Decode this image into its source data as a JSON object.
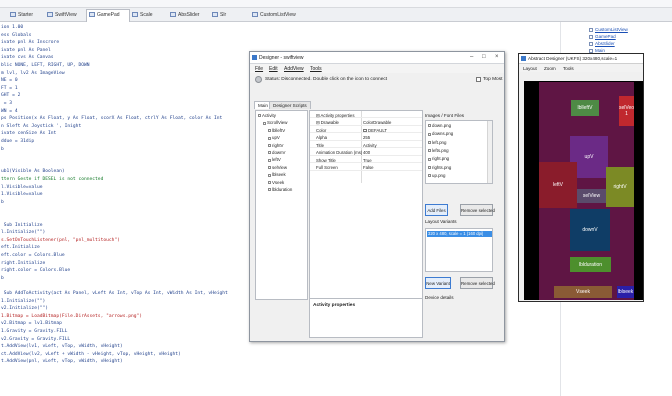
{
  "ide_tabs": [
    {
      "label": "Starter"
    },
    {
      "label": "SwiftView"
    },
    {
      "label": "GamePad",
      "active": true
    },
    {
      "label": "Scale"
    },
    {
      "label": "AbsSlider"
    },
    {
      "label": "Slr"
    },
    {
      "label": "CustomListView"
    }
  ],
  "code_lines": [
    {
      "text": "ion 1.00",
      "style": "blue"
    },
    {
      "text": "ess Globals",
      "style": "blue"
    },
    {
      "text": "ivate pnl As Inscrore",
      "style": "blue"
    },
    {
      "text": "ivate pnl As Panel",
      "style": "blue"
    },
    {
      "text": "ivate cvs As Canvas",
      "style": "blue"
    },
    {
      "text": "blic NONE, LEFT, RIGHT, UP, DOWN",
      "style": "blue"
    },
    {
      "text": "m lvl, lv2 As ImageView",
      "style": "blue"
    },
    {
      "text": "NE = 0",
      "style": "blue"
    },
    {
      "text": "FT = 1",
      "style": "blue"
    },
    {
      "text": "GHT = 2",
      "style": "blue"
    },
    {
      "text": " = 3",
      "style": "blue"
    },
    {
      "text": "WN = 4",
      "style": "blue"
    },
    {
      "text": "ps Position(x As Float, y As Float, scorX As Float, ctrlY As Float, color As Int",
      "style": "blue"
    },
    {
      "text": "n Sleft As Joystick ', Inight",
      "style": "blue"
    },
    {
      "text": "ivate cenSize As Int",
      "style": "blue"
    },
    {
      "text": "ddue = 31dip",
      "style": "blue"
    },
    {
      "text": "b",
      "style": "blue"
    },
    {
      "text": "",
      "style": "blue"
    },
    {
      "text": "",
      "style": "blue"
    },
    {
      "text": "ub1(Visible As Boolean)",
      "style": "blue"
    },
    {
      "text": "ttern Geste if DESEL is not connected",
      "style": "green"
    },
    {
      "text": "l.Visible=value",
      "style": "blue"
    },
    {
      "text": "1.Visible=value",
      "style": "blue"
    },
    {
      "text": "b",
      "style": "blue"
    },
    {
      "text": "",
      "style": "blue"
    },
    {
      "text": "",
      "style": "blue"
    },
    {
      "text": " Sub Initialize",
      "style": "blue"
    },
    {
      "text": "l.Initialize(\"\")",
      "style": "blue"
    },
    {
      "text": "s.SetOnTouchListener(pnl, \"pnl_multitouch\")",
      "style": "red"
    },
    {
      "text": "eft.Initialize",
      "style": "blue"
    },
    {
      "text": "eft.color = Colors.Blue",
      "style": "blue"
    },
    {
      "text": "right.Initialize",
      "style": "blue"
    },
    {
      "text": "right.color = Colors.Blue",
      "style": "blue"
    },
    {
      "text": "b",
      "style": "blue"
    },
    {
      "text": "",
      "style": "blue"
    },
    {
      "text": " Sub AddToActivity(act As Panel, vLeft As Int, vTop As Int, vWidth As Int, vHeight",
      "style": "blue"
    },
    {
      "text": "1.Initialize(\"\")",
      "style": "blue"
    },
    {
      "text": "v2.Initialize(\"\")",
      "style": "blue"
    },
    {
      "text": "1.Bitmap = LoadBitmap(File.DirAssets, \"arrows.png\")",
      "style": "red"
    },
    {
      "text": "v2.Bitmap = lv1.Bitmap",
      "style": "blue"
    },
    {
      "text": "1.Gravity = Gravity.FILL",
      "style": "blue"
    },
    {
      "text": "v2.Gravity = Gravity.FILL",
      "style": "blue"
    },
    {
      "text": "t.AddView(lv1, vLeft, vTop, vWidth, vHeight)",
      "style": "blue"
    },
    {
      "text": "ct.AddView(lv2, vLeft + vWidth - vHeight, vTop, vHeight, vHeight)",
      "style": "blue"
    },
    {
      "text": "t.AddView(pnl, vLeft, vTop, vWidth, vHeight)",
      "style": "blue"
    }
  ],
  "modules": [
    {
      "label": "CustomListView"
    },
    {
      "label": "GamePad"
    },
    {
      "label": "AbsSlider"
    },
    {
      "label": "Main"
    },
    {
      "label": "Scale"
    },
    {
      "label": "Starter"
    },
    {
      "label": "SwiftView"
    }
  ],
  "designer": {
    "title": "Designer - swiftview",
    "menu": [
      "File",
      "Edit",
      "AddView",
      "Tools"
    ],
    "status": "Status: Disconnected. Double click on the icon to connect",
    "topmost_label": "Top Most",
    "tabs": [
      "Main",
      "Designer Scripts"
    ],
    "tree": [
      {
        "label": "Activity",
        "level": 0
      },
      {
        "label": "ScrollView",
        "level": 1
      },
      {
        "label": "lblleftV",
        "level": 2
      },
      {
        "label": "upV",
        "level": 2
      },
      {
        "label": "rightV",
        "level": 2
      },
      {
        "label": "downV",
        "level": 2
      },
      {
        "label": "leftV",
        "level": 2
      },
      {
        "label": "selView",
        "level": 2
      },
      {
        "label": "lblseek",
        "level": 2
      },
      {
        "label": "Vseek",
        "level": 2
      },
      {
        "label": "lblduration",
        "level": 2
      }
    ],
    "props": [
      {
        "name": "Activity properties",
        "value": "",
        "header": true
      },
      {
        "name": "Drawable",
        "value": "ColorDrawable",
        "header": true
      },
      {
        "name": "Color",
        "value": "DEFAULT",
        "swatch": true
      },
      {
        "name": "Alpha",
        "value": "255"
      },
      {
        "name": "Title",
        "value": "Activity"
      },
      {
        "name": "Animation Duration (ms)",
        "value": "400"
      },
      {
        "name": "Show Title",
        "value": "True"
      },
      {
        "name": "Full Screen",
        "value": "False"
      }
    ],
    "props_bottom_title": "Activity properties",
    "files_label": "Images / Font Files",
    "files": [
      "down.png",
      "downs.png",
      "left.png",
      "lefts.png",
      "right.png",
      "rights.png",
      "up.png"
    ],
    "add_files_label": "Add Files",
    "remove_selected_label": "Remove selected",
    "variants_label": "Layout Variants",
    "variants": [
      "320 x 480, scale = 1 (160 dpi)"
    ],
    "new_variant_label": "New Variant",
    "remove_variant_label": "Remove selected",
    "device_details": "Device details"
  },
  "abstract": {
    "title": "Abstract Designer (UKFS) 320x480,scale=1",
    "menu": [
      "Layout",
      "Zoom",
      "Tools"
    ],
    "views": [
      {
        "label": "lblleftV",
        "color": "#4e8a45"
      },
      {
        "label": "selVeo 1",
        "color": "#c0282e"
      },
      {
        "label": "upV",
        "color": "#6b2a86"
      },
      {
        "label": "leftV",
        "color": "#8a1c2b"
      },
      {
        "label": "rightV",
        "color": "#7c8a25"
      },
      {
        "label": "selView",
        "color": "#5a4b6b"
      },
      {
        "label": "downV",
        "color": "#0f3d66"
      },
      {
        "label": "lblduration",
        "color": "#4d8f2d"
      },
      {
        "label": "Vseek",
        "color": "#8a5a35"
      },
      {
        "label": "lblseek",
        "color": "#2a1fa8"
      }
    ]
  }
}
